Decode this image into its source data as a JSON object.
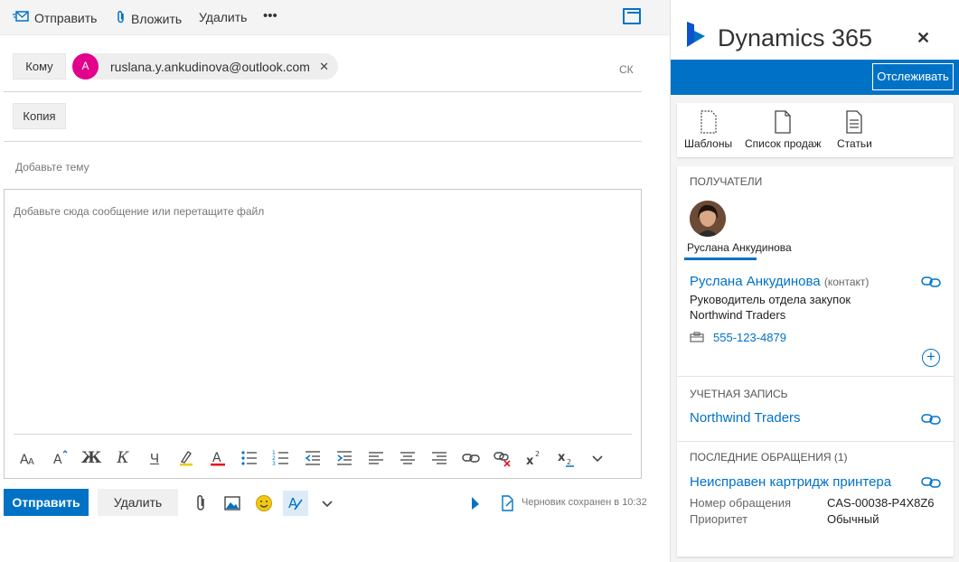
{
  "toolbar": {
    "send_label": "Отправить",
    "attach_label": "Вложить",
    "delete_label": "Удалить",
    "more_label": "•••"
  },
  "recipients": {
    "to_label": "Кому",
    "cc_label": "Копия",
    "bcc_label": "СК",
    "to_chip": {
      "initial": "A",
      "address": "ruslana.y.ankudinova@outlook.com",
      "color": "#e3008c"
    }
  },
  "subject": {
    "placeholder": "Добавьте тему"
  },
  "body": {
    "placeholder": "Добавьте сюда сообщение или перетащите файл"
  },
  "formatting": [
    "font-size-icon",
    "grow-font-icon",
    "bold-icon",
    "italic-icon",
    "underline-icon",
    "highlight-icon",
    "font-color-icon",
    "bullets-icon",
    "numbering-icon",
    "outdent-icon",
    "indent-icon",
    "align-left-icon",
    "align-center-icon",
    "align-right-icon",
    "insert-link-icon",
    "remove-link-icon",
    "superscript-icon",
    "subscript-icon",
    "more-format-icon"
  ],
  "formatting_labels": {
    "bold": "Ж",
    "italic": "К",
    "underline": "Ч",
    "color_letter": "A",
    "size_letter": "A"
  },
  "footer": {
    "send_label": "Отправить",
    "discard_label": "Удалить",
    "status": "Черновик сохранен в 10:32"
  },
  "colors": {
    "accent": "#0072c6",
    "avatar": "#e3008c"
  },
  "dynamics": {
    "title": "Dynamics 365",
    "track_label": "Отслеживать",
    "tools": [
      {
        "label": "Шаблоны",
        "icon": "templates-icon"
      },
      {
        "label": "Список продаж",
        "icon": "sales-list-icon"
      },
      {
        "label": "Статьи",
        "icon": "articles-icon"
      }
    ],
    "recipients_header": "ПОЛУЧАТЕЛИ",
    "recipient_name": "Руслана Анкудинова",
    "contact": {
      "name": "Руслана Анкудинова",
      "tag": "(контакт)",
      "job_title": "Руководитель отдела закупок",
      "company": "Northwind Traders",
      "phone": "555-123-4879"
    },
    "account_header": "УЧЕТНАЯ ЗАПИСЬ",
    "account_name": "Northwind Traders",
    "cases_header": "ПОСЛЕДНИЕ ОБРАЩЕНИЯ (1)",
    "case": {
      "title": "Неисправен картридж принтера",
      "number_label": "Номер обращения",
      "number_value": "CAS-00038-P4X8Z6",
      "priority_label": "Приоритет",
      "priority_value": "Обычный"
    }
  }
}
